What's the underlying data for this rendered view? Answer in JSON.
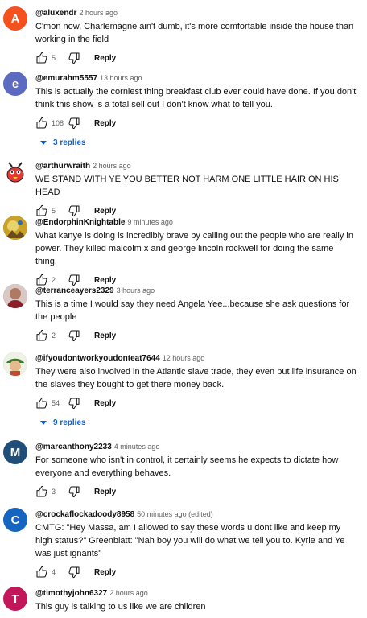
{
  "comments": [
    {
      "handle": "@aluxendr",
      "time": "2 hours ago",
      "text": "C'mon now, Charlemagne ain't dumb, it's more comfortable inside the house than working in the field",
      "likes": "5",
      "reply": "Reply",
      "avatar": {
        "letter": "A",
        "color": "#f4511e"
      }
    },
    {
      "handle": "@emurahm5557",
      "time": "13 hours ago",
      "text": "This is actually the corniest thing breakfast club ever could have done. If you don't think this show is a total sell out I don't know what to tell you.",
      "likes": "108",
      "reply": "Reply",
      "replies": "3 replies",
      "avatar": {
        "letter": "e",
        "color": "#5c6bc0"
      }
    },
    {
      "handle": "@arthurwraith",
      "time": "2 hours ago",
      "text": "WE STAND WITH YE YOU BETTER NOT HARM ONE LITTLE HAIR ON HIS HEAD",
      "likes": "5",
      "reply": "Reply",
      "avatar": {
        "icon": "red-bird-mascot-icon"
      }
    },
    {
      "handle": "@EndorphinKnightable",
      "time": "9 minutes ago",
      "text": "What kanye is doing is incredibly brave by calling out the people who are really in power. They killed malcolm x and george lincoln rockwell for doing the same thing.",
      "likes": "2",
      "reply": "Reply",
      "avatar": {
        "icon": "yellow-artwork-avatar"
      }
    },
    {
      "handle": "@terranceayers2329",
      "time": "3 hours ago",
      "text": "This is a time I would say they need Angela Yee...because she ask questions for the people",
      "likes": "2",
      "reply": "Reply",
      "avatar": {
        "icon": "photo-avatar"
      }
    },
    {
      "handle": "@ifyoudontworkyoudonteat7644",
      "time": "12 hours ago",
      "text": "They were also involved in the Atlantic slave trade, they even put life insurance on the slaves they bought to get there money back.",
      "likes": "54",
      "reply": "Reply",
      "replies": "9 replies",
      "avatar": {
        "icon": "cartoon-avatar"
      }
    },
    {
      "handle": "@marcanthony2233",
      "time": "4 minutes ago",
      "text": "For someone who isn't in control, it certainly seems he expects to dictate how everyone and everything behaves.",
      "likes": "3",
      "reply": "Reply",
      "avatar": {
        "letter": "M",
        "color": "#1f4e79"
      }
    },
    {
      "handle": "@crockaflockadoody8958",
      "time": "50 minutes ago (edited)",
      "text": "CMTG: \"Hey Massa, am I allowed to say these words u dont like and keep my high status?\" Greenblatt: \"Nah boy you will do what we tell you to. Kyrie and Ye was just ignants\"",
      "likes": "4",
      "reply": "Reply",
      "avatar": {
        "letter": "C",
        "color": "#1565c0"
      }
    },
    {
      "handle": "@timothyjohn6327",
      "time": "2 hours ago",
      "text": "This guy is talking to us like we are children",
      "avatar": {
        "letter": "T",
        "color": "#c2185b"
      }
    }
  ]
}
